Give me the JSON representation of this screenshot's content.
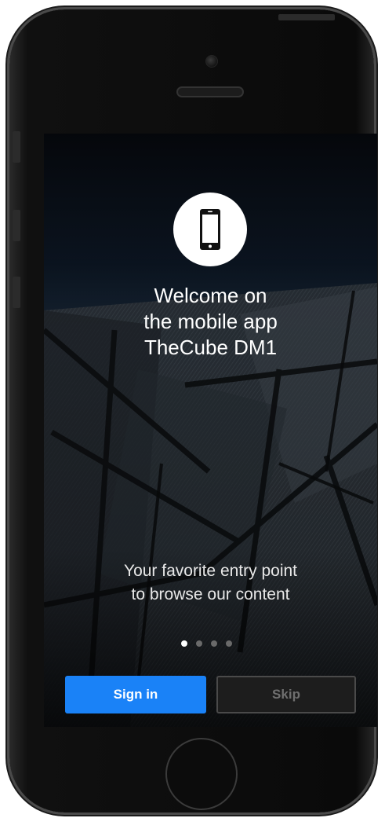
{
  "welcome": {
    "title_lines": [
      "Welcome on",
      "the mobile app",
      "TheCube DM1"
    ],
    "icon": "smartphone-icon"
  },
  "tagline": {
    "lines": [
      "Your favorite entry point",
      "to browse our content"
    ]
  },
  "pager": {
    "count": 4,
    "active_index": 0
  },
  "actions": {
    "signin_label": "Sign in",
    "skip_label": "Skip"
  },
  "colors": {
    "primary": "#1a82f7",
    "skip_text": "#6f6f6f",
    "dot_active": "#ffffff",
    "dot_inactive": "#6a6a6a"
  }
}
